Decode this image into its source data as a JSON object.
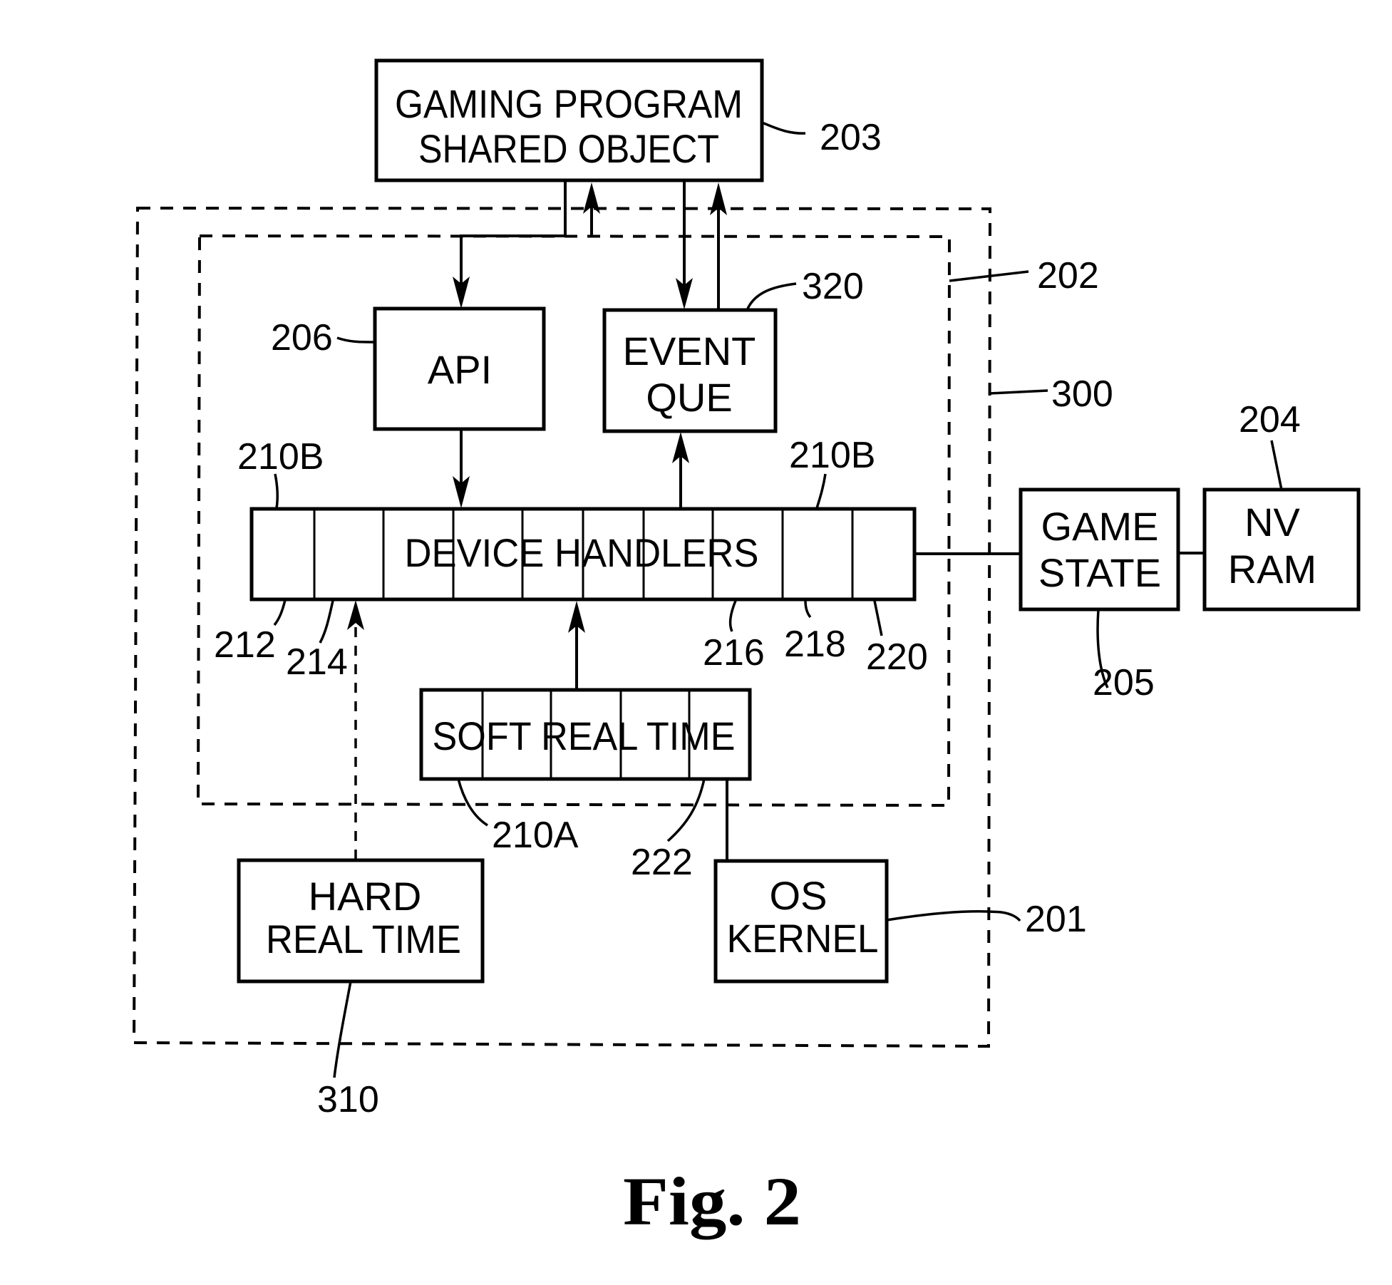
{
  "figure": {
    "caption": "Fig. 2",
    "blocks": {
      "gaming_program": {
        "line1": "GAMING PROGRAM",
        "line2": "SHARED OBJECT",
        "ref": "203"
      },
      "api": {
        "label": "API",
        "ref": "206"
      },
      "event_que": {
        "line1": "EVENT",
        "line2": "QUE",
        "ref": "320"
      },
      "device_handlers": {
        "label": "DEVICE HANDLERS",
        "ref_left": "210B",
        "ref_right": "210B"
      },
      "soft_real_time": {
        "label": "SOFT REAL TIME",
        "ref": "210A"
      },
      "hard_real_time": {
        "line1": "HARD",
        "line2": "REAL TIME",
        "ref": "310"
      },
      "os_kernel": {
        "line1": "OS",
        "line2": "KERNEL",
        "ref": "201"
      },
      "game_state": {
        "line1": "GAME",
        "line2": "STATE",
        "ref": "205"
      },
      "nv_ram": {
        "line1": "NV",
        "line2": "RAM",
        "ref": "204"
      }
    },
    "regions": {
      "inner": {
        "ref": "202"
      },
      "outer": {
        "ref": "300"
      }
    },
    "handler_refs": {
      "h212": "212",
      "h214": "214",
      "h216": "216",
      "h218": "218",
      "h220": "220",
      "h222": "222"
    }
  }
}
